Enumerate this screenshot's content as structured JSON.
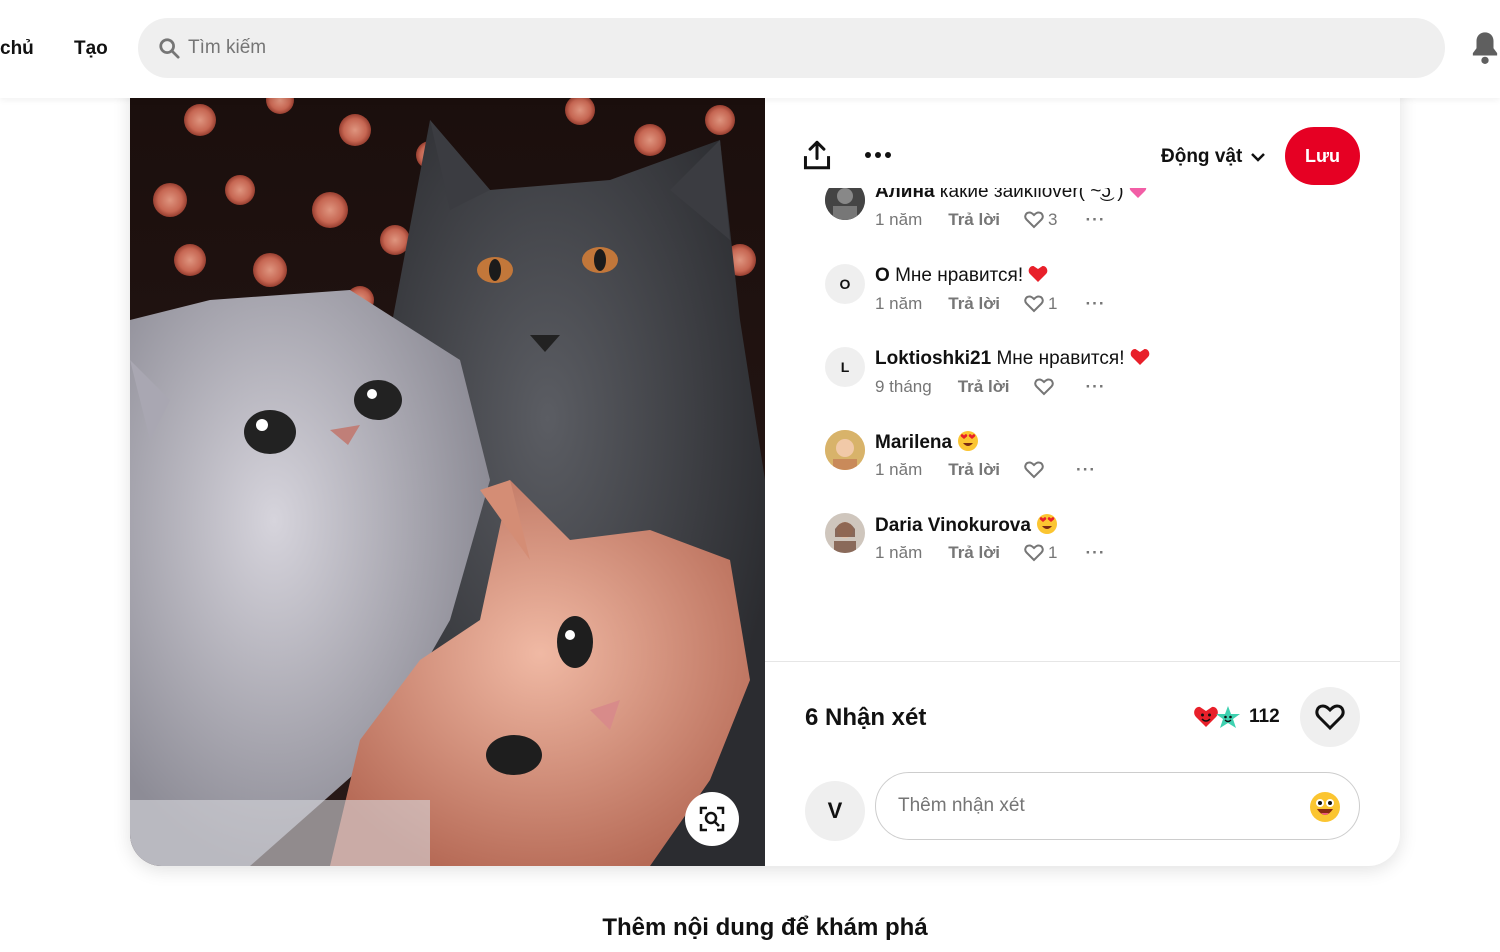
{
  "nav": {
    "home_label": "chủ",
    "create_label": "Tạo"
  },
  "search": {
    "placeholder": "Tìm kiếm"
  },
  "pin": {
    "board_label": "Động vật",
    "save_label": "Lưu"
  },
  "comments": [
    {
      "author": "Алина",
      "text": "какие заиkilover( ~͜ʖ˘)",
      "emoji": "pink-heart",
      "time": "1 năm",
      "reply": "Trả lời",
      "likes": "3",
      "avatar_letter": ""
    },
    {
      "author": "O",
      "text": "Мне нравится!",
      "emoji": "red-heart",
      "time": "1 năm",
      "reply": "Trả lời",
      "likes": "1",
      "avatar_letter": "O"
    },
    {
      "author": "Loktioshki21",
      "text": "Мне нравится!",
      "emoji": "red-heart",
      "time": "9 tháng",
      "reply": "Trả lời",
      "likes": "",
      "avatar_letter": "L"
    },
    {
      "author": "Marilena",
      "text": "",
      "emoji": "heart-eyes",
      "time": "1 năm",
      "reply": "Trả lời",
      "likes": "",
      "avatar_letter": ""
    },
    {
      "author": "Daria Vinokurova",
      "text": "",
      "emoji": "heart-eyes",
      "time": "1 năm",
      "reply": "Trả lời",
      "likes": "1",
      "avatar_letter": ""
    }
  ],
  "footer": {
    "comment_count": "6 Nhận xét",
    "reaction_count": "112",
    "my_avatar": "V",
    "comment_placeholder": "Thêm nhận xét"
  },
  "more_title": "Thêm nội dung để khám phá",
  "colors": {
    "accent": "#e60023",
    "muted": "#767676",
    "field_bg": "#efefef"
  }
}
